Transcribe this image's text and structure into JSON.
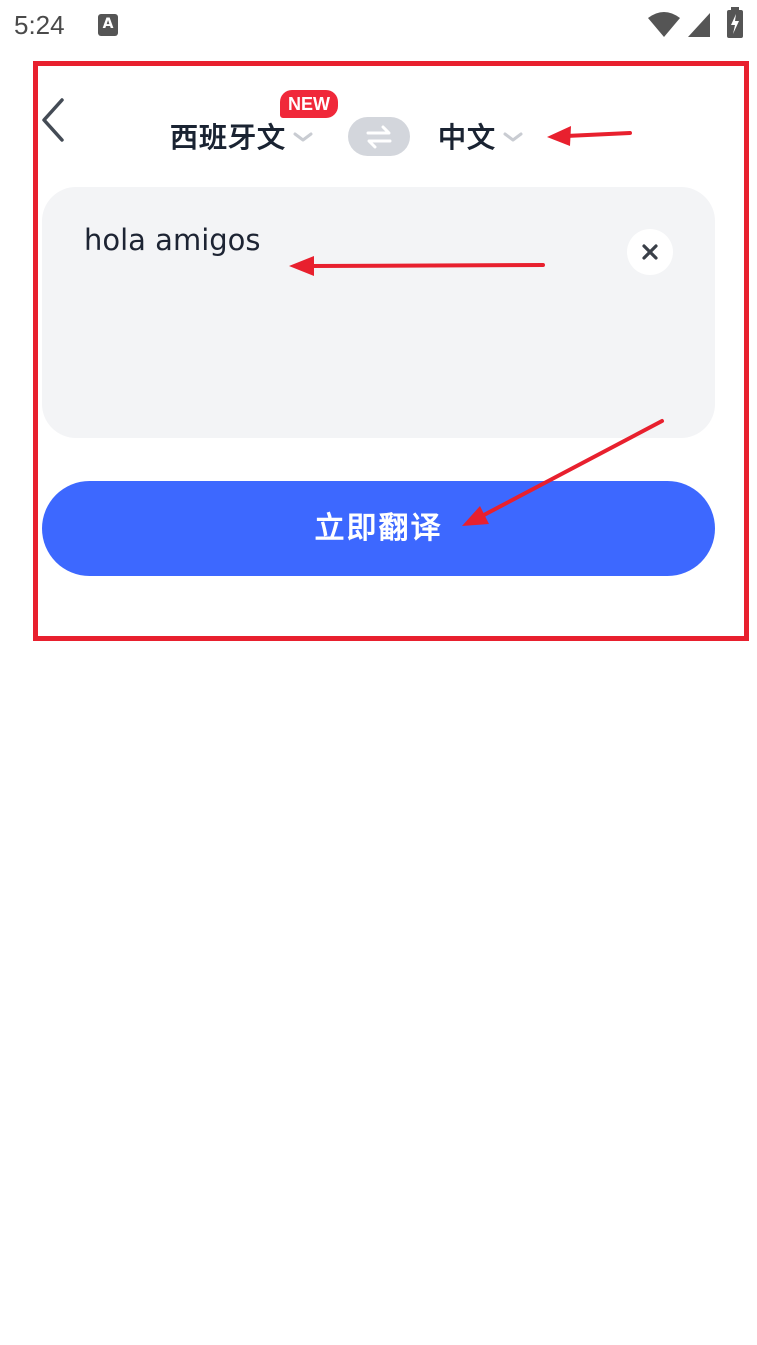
{
  "status_bar": {
    "time": "5:24",
    "notification_icon_letter": "A",
    "icons": [
      "wifi-icon",
      "signal-icon",
      "battery-charging-icon"
    ]
  },
  "header": {
    "source_language": "西班牙文",
    "new_badge": "NEW",
    "target_language": "中文"
  },
  "input": {
    "value": "hola amigos"
  },
  "action": {
    "translate_label": "立即翻译"
  },
  "colors": {
    "accent": "#3d68ff",
    "badge": "#f0283a",
    "annotation": "#e8202e",
    "input_bg": "#f3f4f6"
  }
}
